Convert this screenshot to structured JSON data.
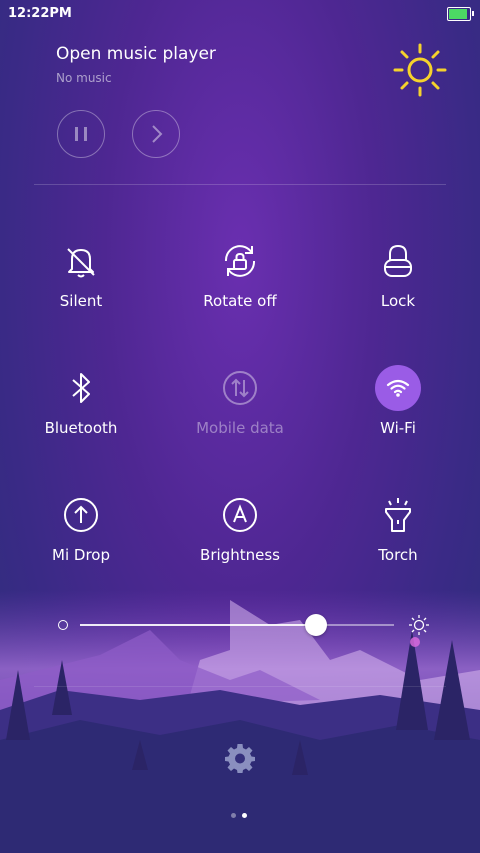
{
  "status": {
    "time": "12:22PM",
    "battery_percent": 100
  },
  "music": {
    "title": "Open music player",
    "subtitle": "No music"
  },
  "tiles": [
    {
      "label": "Silent",
      "icon": "bell-off-icon",
      "active": false
    },
    {
      "label": "Rotate off",
      "icon": "rotate-lock-icon",
      "active": false
    },
    {
      "label": "Lock",
      "icon": "lock-icon",
      "active": false
    },
    {
      "label": "Bluetooth",
      "icon": "bluetooth-icon",
      "active": false
    },
    {
      "label": "Mobile data",
      "icon": "mobile-data-icon",
      "active": false,
      "disabled": true
    },
    {
      "label": "Wi-Fi",
      "icon": "wifi-icon",
      "active": true
    },
    {
      "label": "Mi Drop",
      "icon": "upload-circle-icon",
      "active": false
    },
    {
      "label": "Brightness",
      "icon": "auto-brightness-icon",
      "active": false
    },
    {
      "label": "Torch",
      "icon": "flashlight-icon",
      "active": false
    }
  ],
  "brightness": {
    "level": 0.75
  },
  "pager": {
    "pages": 2,
    "current": 2
  },
  "colors": {
    "accent": "#9a5ce6",
    "sun": "#f5d22c"
  }
}
